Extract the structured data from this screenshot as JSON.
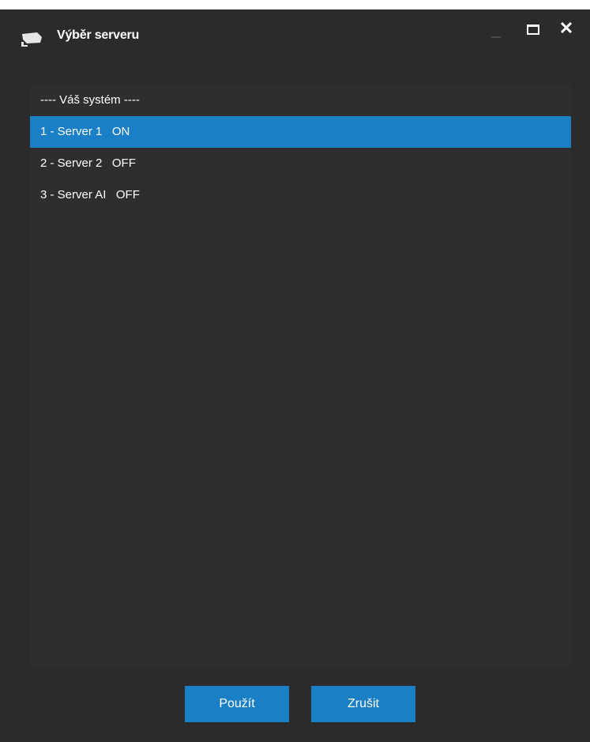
{
  "window": {
    "title": "Výběr serveru",
    "icon": "camera-icon"
  },
  "title_controls": [
    "minimize-icon",
    "maximize-icon",
    "close-icon"
  ],
  "server_list": {
    "header": "---- Váš systém ----",
    "items": [
      {
        "label": "1 - Server 1   ON",
        "selected": true
      },
      {
        "label": "2 - Server 2   OFF",
        "selected": false
      },
      {
        "label": "3 - Server AI   OFF",
        "selected": false
      }
    ]
  },
  "buttons": {
    "apply": "Použít",
    "cancel": "Zrušit"
  },
  "colors": {
    "window_bg": "#2b2b2b",
    "list_bg": "#2e2e2e",
    "accent": "#1a7fc4",
    "text": "#ffffff"
  }
}
